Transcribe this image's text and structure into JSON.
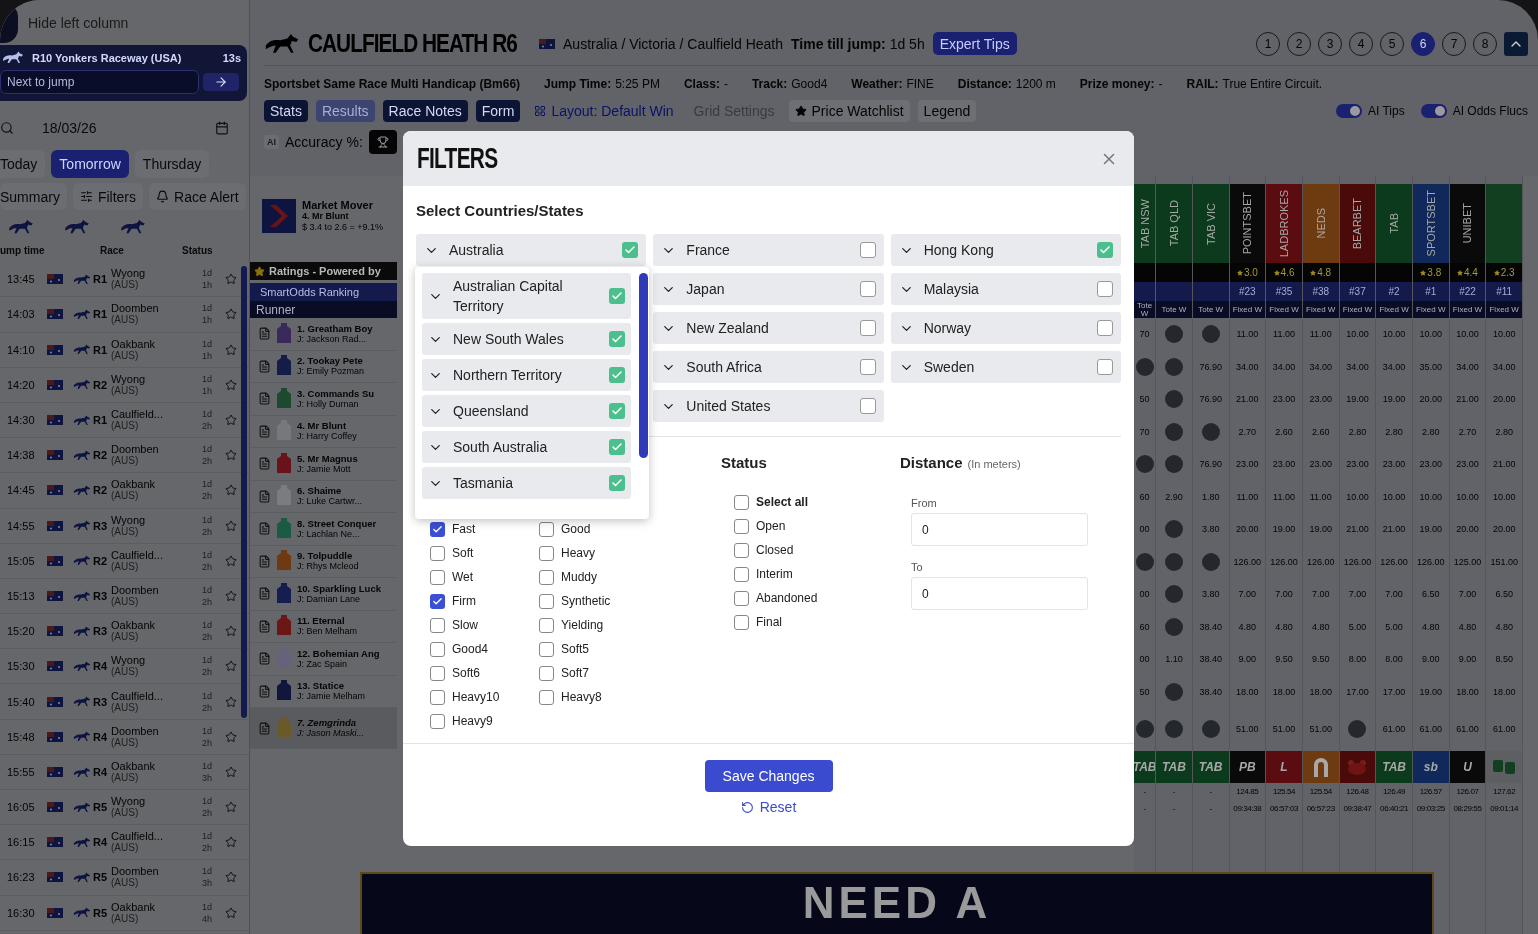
{
  "sidebar": {
    "hide_button": "Hide left column",
    "next_race": {
      "title": "R10  Yonkers Raceway  (USA)",
      "countdown": "13s",
      "placeholder": "Next to jump"
    },
    "date": "18/03/26",
    "day_tabs": [
      {
        "label": "Today",
        "selected": false
      },
      {
        "label": "Tomorrow",
        "selected": true
      },
      {
        "label": "Thursday",
        "selected": false
      }
    ],
    "actions": [
      "Summary",
      "Filters",
      "Race Alert"
    ],
    "columns": [
      "ump time",
      "Race",
      "Status"
    ],
    "races": [
      {
        "time": "13:45",
        "race": "R1",
        "venue": "Wyong",
        "country": "(AUS)",
        "days": "1d",
        "hours": "1h"
      },
      {
        "time": "14:03",
        "race": "R1",
        "venue": "Doomben",
        "country": "(AUS)",
        "days": "1d",
        "hours": "1h"
      },
      {
        "time": "14:10",
        "race": "R1",
        "venue": "Oakbank",
        "country": "(AUS)",
        "days": "1d",
        "hours": "1h"
      },
      {
        "time": "14:20",
        "race": "R2",
        "venue": "Wyong",
        "country": "(AUS)",
        "days": "1d",
        "hours": "1h"
      },
      {
        "time": "14:30",
        "race": "R1",
        "venue": "Caulfield...",
        "country": "(AUS)",
        "days": "1d",
        "hours": "2h"
      },
      {
        "time": "14:38",
        "race": "R2",
        "venue": "Doomben",
        "country": "(AUS)",
        "days": "1d",
        "hours": "2h"
      },
      {
        "time": "14:45",
        "race": "R2",
        "venue": "Oakbank",
        "country": "(AUS)",
        "days": "1d",
        "hours": "2h"
      },
      {
        "time": "14:55",
        "race": "R3",
        "venue": "Wyong",
        "country": "(AUS)",
        "days": "1d",
        "hours": "2h"
      },
      {
        "time": "15:05",
        "race": "R2",
        "venue": "Caulfield...",
        "country": "(AUS)",
        "days": "1d",
        "hours": "2h"
      },
      {
        "time": "15:13",
        "race": "R3",
        "venue": "Doomben",
        "country": "(AUS)",
        "days": "1d",
        "hours": "2h"
      },
      {
        "time": "15:20",
        "race": "R3",
        "venue": "Oakbank",
        "country": "(AUS)",
        "days": "1d",
        "hours": "2h"
      },
      {
        "time": "15:30",
        "race": "R4",
        "venue": "Wyong",
        "country": "(AUS)",
        "days": "1d",
        "hours": "2h"
      },
      {
        "time": "15:40",
        "race": "R3",
        "venue": "Caulfield...",
        "country": "(AUS)",
        "days": "1d",
        "hours": "2h"
      },
      {
        "time": "15:48",
        "race": "R4",
        "venue": "Doomben",
        "country": "(AUS)",
        "days": "1d",
        "hours": "2h"
      },
      {
        "time": "15:55",
        "race": "R4",
        "venue": "Oakbank",
        "country": "(AUS)",
        "days": "1d",
        "hours": "3h"
      },
      {
        "time": "16:05",
        "race": "R5",
        "venue": "Wyong",
        "country": "(AUS)",
        "days": "1d",
        "hours": "2h"
      },
      {
        "time": "16:15",
        "race": "R4",
        "venue": "Caulfield...",
        "country": "(AUS)",
        "days": "1d",
        "hours": "2h"
      },
      {
        "time": "16:23",
        "race": "R5",
        "venue": "Doomben",
        "country": "(AUS)",
        "days": "1d",
        "hours": "3h"
      },
      {
        "time": "16:30",
        "race": "R5",
        "venue": "Oakbank",
        "country": "(AUS)",
        "days": "1d",
        "hours": "4h"
      }
    ]
  },
  "header": {
    "title": "CAULFIELD HEATH R6",
    "breadcrumb": "Australia / Victoria / Caulfield Heath",
    "jump_label": "Time till jump:",
    "jump_value": "1d 5h",
    "tips_button": "Expert Tips",
    "race_numbers": [
      {
        "label": "1",
        "selected": false
      },
      {
        "label": "2",
        "selected": false
      },
      {
        "label": "3",
        "selected": false
      },
      {
        "label": "4",
        "selected": false
      },
      {
        "label": "5",
        "selected": false
      },
      {
        "label": "6",
        "selected": true
      },
      {
        "label": "7",
        "selected": false
      },
      {
        "label": "8",
        "selected": false
      }
    ]
  },
  "race_name": "Sportsbet Same Race Multi Handicap (Bm66)",
  "race_info": [
    {
      "label": "Jump Time:",
      "value": "5:25 PM"
    },
    {
      "label": "Class:",
      "value": "-"
    },
    {
      "label": "Track:",
      "value": "Good4"
    },
    {
      "label": "Weather:",
      "value": "FINE"
    },
    {
      "label": "Distance:",
      "value": "1200 m"
    },
    {
      "label": "Prize money:",
      "value": "-"
    },
    {
      "label": "RAIL:",
      "value": "True Entire Circuit."
    }
  ],
  "toolbar": [
    {
      "label": "Stats",
      "kind": "button",
      "disabled": false
    },
    {
      "label": "Results",
      "kind": "button",
      "disabled": true
    },
    {
      "label": "Race Notes",
      "kind": "button",
      "disabled": false
    },
    {
      "label": "Form",
      "kind": "button",
      "disabled": false
    },
    {
      "label": "Layout: Default Win",
      "kind": "link",
      "disabled": false
    },
    {
      "label": "Grid Settings",
      "kind": "plain",
      "disabled": true
    },
    {
      "label": "Price Watchlist",
      "kind": "watch",
      "disabled": false
    },
    {
      "label": "Legend",
      "kind": "chip",
      "disabled": false
    }
  ],
  "toggles": [
    {
      "label": "AI Tips",
      "on": true
    },
    {
      "label": "AI Odds Flucs",
      "on": true
    }
  ],
  "ai_badge": "AI",
  "accuracy_label": "Accuracy %:",
  "market_mover": {
    "title": "Market Mover",
    "runner": "4. Mr Blunt",
    "change": "$ 3.4 to 2.6 = +9.1%"
  },
  "ratings_title": "Ratings - Powered by",
  "rankings_title": "SmartOdds Ranking",
  "runner_header": "Runner",
  "runners": [
    {
      "name": "1. Greatham Boy",
      "jockey": "J: Jackson Rad...",
      "color": "#3a2a5c",
      "scratched": false
    },
    {
      "name": "2. Tookay Pete",
      "jockey": "J: Emily Pozman",
      "color": "#141c48",
      "scratched": false
    },
    {
      "name": "3. Commands Su",
      "jockey": "J: Holly Durnan",
      "color": "#1d4a2e",
      "scratched": false
    },
    {
      "name": "4. Mr Blunt",
      "jockey": "J: Harry Coffey",
      "color": "#78787c",
      "scratched": false
    },
    {
      "name": "5. Mr Magnus",
      "jockey": "J: Jamie Mott",
      "color": "#6a121c",
      "scratched": false
    },
    {
      "name": "6. Shaime",
      "jockey": "J: Luke Cartwr...",
      "color": "#7c7c80",
      "scratched": false
    },
    {
      "name": "8. Street Conquer",
      "jockey": "J: Lachlan Ne...",
      "color": "#1c5a44",
      "scratched": false
    },
    {
      "name": "9. Tolpuddle",
      "jockey": "J: Rhys Mcleod",
      "color": "#6e3a12",
      "scratched": false
    },
    {
      "name": "10. Sparkling Luck",
      "jockey": "J: Damian Lane",
      "color": "#161e50",
      "scratched": false
    },
    {
      "name": "11. Eternal",
      "jockey": "J: Ben Melham",
      "color": "#6c1616",
      "scratched": false
    },
    {
      "name": "12. Bohemian Ang",
      "jockey": "J: Zac Spain",
      "color": "#66627a",
      "scratched": false
    },
    {
      "name": "13. Statice",
      "jockey": "J: Jamie Melham",
      "color": "#10163c",
      "scratched": false
    },
    {
      "name": "7. Zemgrinda",
      "jockey": "J: Jason Maski...",
      "color": "#6a5a2a",
      "scratched": true
    }
  ],
  "bookmakers": [
    {
      "name": "TAB NSW",
      "color": "#0b3a1c",
      "type": "Tote W",
      "logo": {
        "kind": "text",
        "text": "TAB"
      },
      "updated": "-",
      "time": "-",
      "cells": [
        {
          "kind": "price",
          "text": "70"
        },
        {
          "kind": "badge"
        },
        {
          "kind": "price",
          "text": "50"
        },
        {
          "kind": "price",
          "text": "70"
        },
        {
          "kind": "badge"
        },
        {
          "kind": "price",
          "text": "60"
        },
        {
          "kind": "price",
          "text": "00"
        },
        {
          "kind": "badge"
        },
        {
          "kind": "price",
          "text": "00"
        },
        {
          "kind": "price",
          "text": "60"
        },
        {
          "kind": "price",
          "text": "00"
        },
        {
          "kind": "price",
          "text": "50"
        },
        {
          "kind": "badge"
        }
      ]
    },
    {
      "name": "TAB QLD",
      "color": "#0b3a1c",
      "type": "Tote W",
      "logo": {
        "kind": "text",
        "text": "TAB"
      },
      "updated": "-",
      "time": "-",
      "cells": [
        {
          "kind": "badge"
        },
        {
          "kind": "badge"
        },
        {
          "kind": "badge"
        },
        {
          "kind": "badge"
        },
        {
          "kind": "badge"
        },
        {
          "kind": "price",
          "text": "2.90"
        },
        {
          "kind": "badge"
        },
        {
          "kind": "badge"
        },
        {
          "kind": "badge"
        },
        {
          "kind": "badge"
        },
        {
          "kind": "price",
          "text": "1.10"
        },
        {
          "kind": "badge"
        },
        {
          "kind": "badge"
        }
      ]
    },
    {
      "name": "TAB VIC",
      "color": "#0b3a1c",
      "type": "Tote W",
      "logo": {
        "kind": "text",
        "text": "TAB"
      },
      "updated": "-",
      "time": "-",
      "cells": [
        {
          "kind": "badge"
        },
        {
          "kind": "price",
          "text": "76.90"
        },
        {
          "kind": "price",
          "text": "76.90"
        },
        {
          "kind": "badge"
        },
        {
          "kind": "price",
          "text": "76.90"
        },
        {
          "kind": "price",
          "text": "1.80"
        },
        {
          "kind": "price",
          "text": "3.80"
        },
        {
          "kind": "badge"
        },
        {
          "kind": "price",
          "text": "3.80"
        },
        {
          "kind": "price",
          "text": "38.40"
        },
        {
          "kind": "price",
          "text": "38.40"
        },
        {
          "kind": "price",
          "text": "38.40"
        },
        {
          "kind": "badge"
        }
      ]
    },
    {
      "name": "POINTSBET",
      "color": "#0a0a0a",
      "rating": "3.0",
      "rank": "#23",
      "type": "Fixed W",
      "logo": {
        "kind": "text",
        "text": "PB"
      },
      "updated": "124.85",
      "time": "09:34:38",
      "cells": [
        {
          "kind": "price",
          "text": "11.00"
        },
        {
          "kind": "price",
          "text": "34.00"
        },
        {
          "kind": "price",
          "text": "21.00"
        },
        {
          "kind": "price",
          "text": "2.70"
        },
        {
          "kind": "price",
          "text": "23.00"
        },
        {
          "kind": "price",
          "text": "11.00"
        },
        {
          "kind": "price",
          "text": "20.00"
        },
        {
          "kind": "price",
          "text": "126.00"
        },
        {
          "kind": "price",
          "text": "7.00"
        },
        {
          "kind": "price",
          "text": "4.80"
        },
        {
          "kind": "price",
          "text": "9.00"
        },
        {
          "kind": "price",
          "text": "18.00"
        },
        {
          "kind": "price",
          "text": "51.00"
        }
      ]
    },
    {
      "name": "LADBROKES",
      "color": "#5a0c10",
      "rating": "4.6",
      "rank": "#35",
      "type": "Fixed W",
      "logo": {
        "kind": "text",
        "text": "L"
      },
      "updated": "125.54",
      "time": "06:57:03",
      "cells": [
        {
          "kind": "price",
          "text": "11.00"
        },
        {
          "kind": "price",
          "text": "34.00"
        },
        {
          "kind": "price",
          "text": "23.00"
        },
        {
          "kind": "price",
          "text": "2.60"
        },
        {
          "kind": "price",
          "text": "23.00"
        },
        {
          "kind": "price",
          "text": "11.00"
        },
        {
          "kind": "price",
          "text": "19.00"
        },
        {
          "kind": "price",
          "text": "126.00"
        },
        {
          "kind": "price",
          "text": "7.00"
        },
        {
          "kind": "price",
          "text": "4.80"
        },
        {
          "kind": "price",
          "text": "9.50"
        },
        {
          "kind": "price",
          "text": "18.00"
        },
        {
          "kind": "price",
          "text": "51.00"
        }
      ]
    },
    {
      "name": "NEDS",
      "color": "#6e3a10",
      "rating": "4.8",
      "rank": "#38",
      "type": "Fixed W",
      "logo": {
        "kind": "arch"
      },
      "updated": "125.54",
      "time": "06:57:23",
      "cells": [
        {
          "kind": "price",
          "text": "11.00"
        },
        {
          "kind": "price",
          "text": "34.00"
        },
        {
          "kind": "price",
          "text": "23.00"
        },
        {
          "kind": "price",
          "text": "2.60"
        },
        {
          "kind": "price",
          "text": "23.00"
        },
        {
          "kind": "price",
          "text": "11.00"
        },
        {
          "kind": "price",
          "text": "19.00"
        },
        {
          "kind": "price",
          "text": "126.00"
        },
        {
          "kind": "price",
          "text": "7.00"
        },
        {
          "kind": "price",
          "text": "4.80"
        },
        {
          "kind": "price",
          "text": "9.50"
        },
        {
          "kind": "price",
          "text": "18.00"
        },
        {
          "kind": "price",
          "text": "51.00"
        }
      ]
    },
    {
      "name": "BEARBET",
      "color": "#4a0a0a",
      "rank": "#37",
      "type": "Fixed W",
      "logo": {
        "kind": "bear"
      },
      "updated": "126.48",
      "time": "09:38:47",
      "cells": [
        {
          "kind": "price",
          "text": "10.00"
        },
        {
          "kind": "price",
          "text": "34.00"
        },
        {
          "kind": "price",
          "text": "19.00"
        },
        {
          "kind": "price",
          "text": "2.80"
        },
        {
          "kind": "price",
          "text": "23.00"
        },
        {
          "kind": "price",
          "text": "10.00"
        },
        {
          "kind": "price",
          "text": "21.00"
        },
        {
          "kind": "price",
          "text": "126.00"
        },
        {
          "kind": "price",
          "text": "7.00"
        },
        {
          "kind": "price",
          "text": "5.00"
        },
        {
          "kind": "price",
          "text": "8.00"
        },
        {
          "kind": "price",
          "text": "17.00"
        },
        {
          "kind": "badge"
        }
      ]
    },
    {
      "name": "TAB",
      "color": "#0b3a1c",
      "rank": "#2",
      "type": "Fixed W",
      "logo": {
        "kind": "text",
        "text": "TAB"
      },
      "updated": "126.49",
      "time": "06:40:21",
      "cells": [
        {
          "kind": "price",
          "text": "10.00"
        },
        {
          "kind": "price",
          "text": "34.00"
        },
        {
          "kind": "price",
          "text": "19.00"
        },
        {
          "kind": "price",
          "text": "2.80"
        },
        {
          "kind": "price",
          "text": "23.00"
        },
        {
          "kind": "price",
          "text": "10.00"
        },
        {
          "kind": "price",
          "text": "21.00"
        },
        {
          "kind": "price",
          "text": "126.00"
        },
        {
          "kind": "price",
          "text": "7.00"
        },
        {
          "kind": "price",
          "text": "5.00"
        },
        {
          "kind": "price",
          "text": "8.00"
        },
        {
          "kind": "price",
          "text": "17.00"
        },
        {
          "kind": "price",
          "text": "61.00"
        }
      ]
    },
    {
      "name": "SPORTSBET",
      "color": "#10295a",
      "rating": "3.8",
      "rank": "#1",
      "type": "Fixed W",
      "logo": {
        "kind": "text",
        "text": "sb"
      },
      "updated": "126.57",
      "time": "09:03:25",
      "cells": [
        {
          "kind": "price",
          "text": "10.00"
        },
        {
          "kind": "price",
          "text": "35.00"
        },
        {
          "kind": "price",
          "text": "20.00"
        },
        {
          "kind": "price",
          "text": "2.80"
        },
        {
          "kind": "price",
          "text": "23.00"
        },
        {
          "kind": "price",
          "text": "10.00"
        },
        {
          "kind": "price",
          "text": "19.00"
        },
        {
          "kind": "price",
          "text": "126.00"
        },
        {
          "kind": "price",
          "text": "6.50"
        },
        {
          "kind": "price",
          "text": "4.80"
        },
        {
          "kind": "price",
          "text": "9.00"
        },
        {
          "kind": "price",
          "text": "19.00"
        },
        {
          "kind": "price",
          "text": "61.00"
        }
      ]
    },
    {
      "name": "UNIBET",
      "color": "#0a0a0a",
      "rating": "4.4",
      "rank": "#22",
      "type": "Fixed W",
      "logo": {
        "kind": "text",
        "text": "U"
      },
      "updated": "126.07",
      "time": "08:29:55",
      "cells": [
        {
          "kind": "price",
          "text": "10.00"
        },
        {
          "kind": "price",
          "text": "34.00"
        },
        {
          "kind": "price",
          "text": "21.00"
        },
        {
          "kind": "price",
          "text": "2.70"
        },
        {
          "kind": "price",
          "text": "23.00"
        },
        {
          "kind": "price",
          "text": "10.00"
        },
        {
          "kind": "price",
          "text": "20.00"
        },
        {
          "kind": "price",
          "text": "125.00"
        },
        {
          "kind": "price",
          "text": "7.00"
        },
        {
          "kind": "price",
          "text": "4.80"
        },
        {
          "kind": "price",
          "text": "9.00"
        },
        {
          "kind": "price",
          "text": "18.00"
        },
        {
          "kind": "price",
          "text": "61.00"
        }
      ]
    },
    {
      "color": "#123f20",
      "rating": "2.3",
      "rank": "#11",
      "type": "Fixed W",
      "logo": {
        "kind": "dice"
      },
      "updated": "127.62",
      "time": "09:01:14",
      "cells": [
        {
          "kind": "price",
          "text": "10.00"
        },
        {
          "kind": "price",
          "text": "34.00"
        },
        {
          "kind": "price",
          "text": "20.00"
        },
        {
          "kind": "price",
          "text": "2.80"
        },
        {
          "kind": "price",
          "text": "21.00"
        },
        {
          "kind": "price",
          "text": "10.00"
        },
        {
          "kind": "price",
          "text": "20.00"
        },
        {
          "kind": "price",
          "text": "151.00"
        },
        {
          "kind": "price",
          "text": "6.50"
        },
        {
          "kind": "price",
          "text": "4.80"
        },
        {
          "kind": "price",
          "text": "8.50"
        },
        {
          "kind": "price",
          "text": "18.00"
        },
        {
          "kind": "price",
          "text": "61.00"
        }
      ]
    }
  ],
  "banner": "NEED A",
  "filters_modal": {
    "title": "FILTERS",
    "countries_heading": "Select Countries/States",
    "country_columns": [
      [
        {
          "name": "Australia",
          "checked": true,
          "children": [
            {
              "name": "Australian Capital Territory",
              "checked": true
            },
            {
              "name": "New South Wales",
              "checked": true
            },
            {
              "name": "Northern Territory",
              "checked": true
            },
            {
              "name": "Queensland",
              "checked": true
            },
            {
              "name": "South Australia",
              "checked": true
            },
            {
              "name": "Tasmania",
              "checked": true
            }
          ]
        }
      ],
      [
        {
          "name": "France",
          "checked": false
        },
        {
          "name": "Japan",
          "checked": false
        },
        {
          "name": "New Zealand",
          "checked": false
        },
        {
          "name": "South Africa",
          "checked": false
        },
        {
          "name": "United States",
          "checked": false
        }
      ],
      [
        {
          "name": "Hong Kong",
          "checked": true
        },
        {
          "name": "Malaysia",
          "checked": false
        },
        {
          "name": "Norway",
          "checked": false
        },
        {
          "name": "Sweden",
          "checked": false
        }
      ]
    ],
    "track_conditions": [
      {
        "label": "Fast",
        "checked": true
      },
      {
        "label": "Good",
        "checked": false
      },
      {
        "label": "Soft",
        "checked": false
      },
      {
        "label": "Heavy",
        "checked": false
      },
      {
        "label": "Wet",
        "checked": false
      },
      {
        "label": "Muddy",
        "checked": false
      },
      {
        "label": "Firm",
        "checked": true
      },
      {
        "label": "Synthetic",
        "checked": false
      },
      {
        "label": "Slow",
        "checked": false
      },
      {
        "label": "Yielding",
        "checked": false
      },
      {
        "label": "Good4",
        "checked": false
      },
      {
        "label": "Soft5",
        "checked": false
      },
      {
        "label": "Soft6",
        "checked": false
      },
      {
        "label": "Soft7",
        "checked": false
      },
      {
        "label": "Heavy10",
        "checked": false
      },
      {
        "label": "Heavy8",
        "checked": false
      },
      {
        "label": "Heavy9",
        "checked": false
      }
    ],
    "status": {
      "heading": "Status",
      "options": [
        {
          "label": "Select all",
          "kind": "all",
          "checked": false
        },
        {
          "label": "Open",
          "kind": "option",
          "checked": false
        },
        {
          "label": "Closed",
          "kind": "option",
          "checked": false
        },
        {
          "label": "Interim",
          "kind": "option",
          "checked": false
        },
        {
          "label": "Abandoned",
          "kind": "option",
          "checked": false
        },
        {
          "label": "Final",
          "kind": "option",
          "checked": false
        }
      ]
    },
    "distance": {
      "heading": "Distance",
      "note": "(In meters)",
      "fields": [
        {
          "label": "From",
          "value": "0"
        },
        {
          "label": "To",
          "value": "0"
        }
      ]
    },
    "save_button": "Save Changes",
    "reset_link": "Reset"
  }
}
